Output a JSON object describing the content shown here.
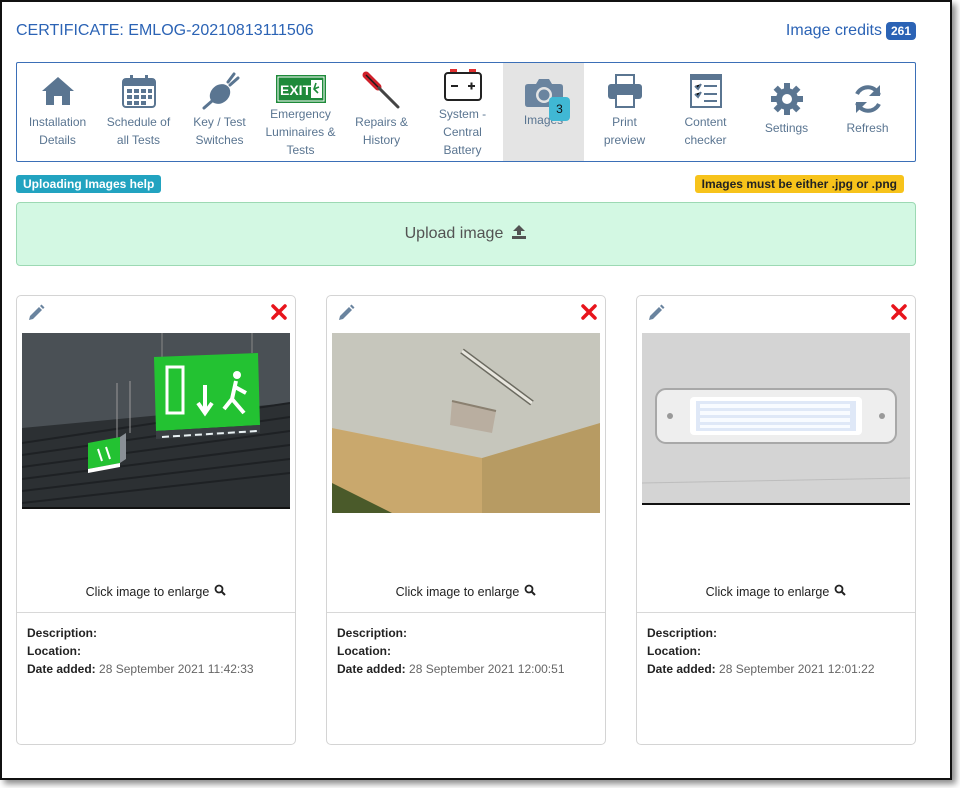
{
  "header": {
    "certificate": "CERTIFICATE: EMLOG-20210813111506",
    "credits_label": "Image credits",
    "credits_count": "261"
  },
  "toolbar": {
    "items": [
      {
        "label": "Installation\nDetails",
        "icon": "house-icon"
      },
      {
        "label": "Schedule of\nall Tests",
        "icon": "calendar-icon"
      },
      {
        "label": "Key / Test\nSwitches",
        "icon": "key-switch-icon"
      },
      {
        "label": "Emergency\nLuminaires &\nTests",
        "icon": "exit-sign-icon",
        "icon_text": "EXIT"
      },
      {
        "label": "Repairs &\nHistory",
        "icon": "screwdriver-icon"
      },
      {
        "label": "System -\nCentral\nBattery",
        "icon": "battery-icon"
      },
      {
        "label": "Images",
        "icon": "camera-icon",
        "count": "3"
      },
      {
        "label": "Print\npreview",
        "icon": "printer-icon"
      },
      {
        "label": "Content\nchecker",
        "icon": "checklist-icon"
      },
      {
        "label": "Settings",
        "icon": "gear-icon"
      },
      {
        "label": "Refresh",
        "icon": "refresh-icon"
      }
    ],
    "active_index": 6
  },
  "help_label": "Uploading Images help",
  "warning_label": "Images must be either .jpg or .png",
  "upload_label": "Upload image",
  "cards": [
    {
      "enlarge": "Click image to enlarge",
      "description_label": "Description:",
      "location_label": "Location:",
      "date_label": "Date added:",
      "date_value": "28 September 2021 11:42:33"
    },
    {
      "enlarge": "Click image to enlarge",
      "description_label": "Description:",
      "location_label": "Location:",
      "date_label": "Date added:",
      "date_value": "28 September 2021 12:00:51"
    },
    {
      "enlarge": "Click image to enlarge",
      "description_label": "Description:",
      "location_label": "Location:",
      "date_label": "Date added:",
      "date_value": "28 September 2021 12:01:22"
    }
  ],
  "colors": {
    "accent": "#2b63b5",
    "upload_bg": "#d3f8e3",
    "help": "#22a3c0",
    "warning": "#f7c31b",
    "delete": "#e8141c"
  }
}
